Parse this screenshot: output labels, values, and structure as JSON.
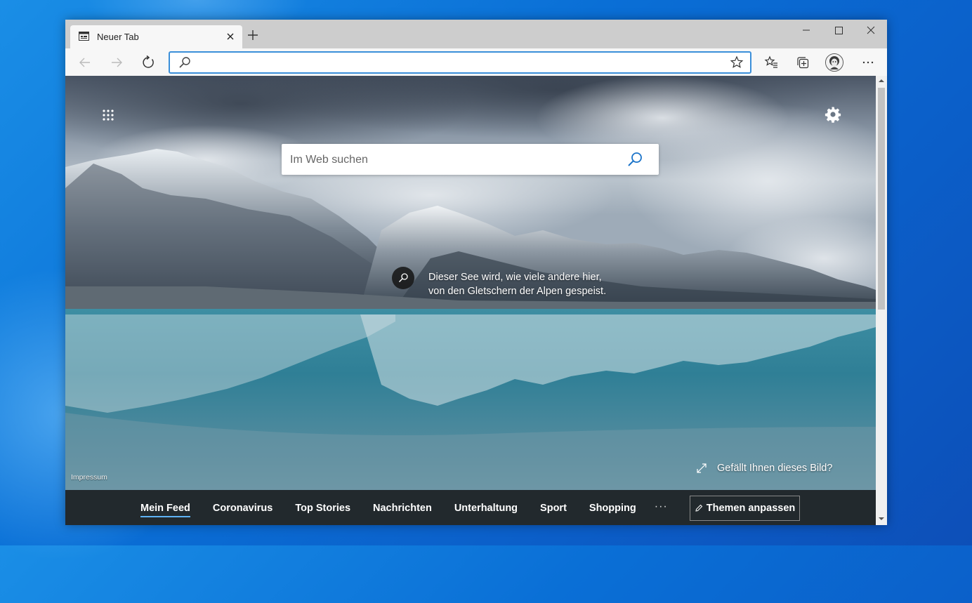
{
  "browser": {
    "tab": {
      "title": "Neuer Tab"
    },
    "address_bar": {
      "value": "",
      "placeholder": ""
    }
  },
  "newtab": {
    "search": {
      "placeholder": "Im Web suchen"
    },
    "caption": {
      "line1": "Dieser See wird, wie viele andere hier,",
      "line2": "von den Gletschern der Alpen gespeist."
    },
    "like_image": "Gefällt Ihnen dieses Bild?",
    "impressum": "Impressum",
    "feed_tabs": [
      {
        "label": "Mein Feed",
        "active": true
      },
      {
        "label": "Coronavirus",
        "active": false
      },
      {
        "label": "Top Stories",
        "active": false
      },
      {
        "label": "Nachrichten",
        "active": false
      },
      {
        "label": "Unterhaltung",
        "active": false
      },
      {
        "label": "Sport",
        "active": false
      },
      {
        "label": "Shopping",
        "active": false
      }
    ],
    "feed_more": "···",
    "theme_button": "Themen anpassen"
  },
  "colors": {
    "accent": "#3b8fd9",
    "feed_active_underline": "#5fb3f5",
    "desktop": "#0a6fd6"
  },
  "icons": {
    "toolbar": [
      "back-icon",
      "forward-icon",
      "refresh-icon",
      "favorites-icon",
      "collections-icon",
      "profile-avatar",
      "more-icon"
    ],
    "page": [
      "apps-grid-icon",
      "settings-gear-icon",
      "search-icon",
      "expand-icon",
      "pencil-icon"
    ]
  }
}
